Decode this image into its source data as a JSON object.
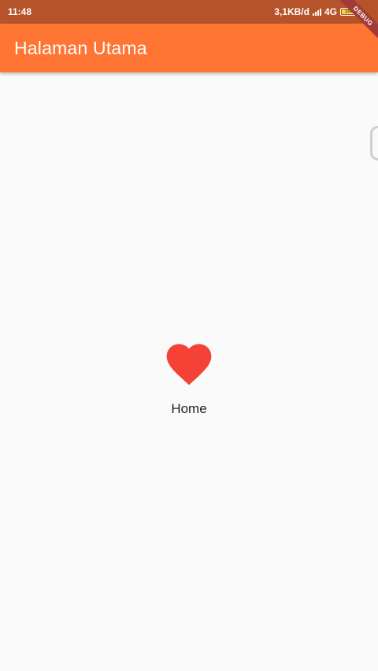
{
  "status_bar": {
    "time": "11:48",
    "network_speed": "3,1KB/d",
    "network_type": "4G",
    "battery_label": "100",
    "background": "#b5532a"
  },
  "app_bar": {
    "title": "Halaman Utama",
    "background": "#ff7534"
  },
  "debug_banner": {
    "label": "DEBUG"
  },
  "body": {
    "icon": "heart-icon",
    "icon_color": "#f44336",
    "label": "Home"
  }
}
